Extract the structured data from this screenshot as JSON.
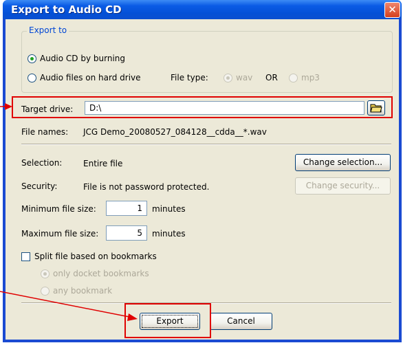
{
  "window": {
    "title": "Export to Audio CD",
    "close_glyph": "✕"
  },
  "export_to": {
    "legend": "Export to",
    "option_burn": "Audio CD by burning",
    "option_files": "Audio files on hard drive",
    "file_type_label": "File type:",
    "wav": "wav",
    "or": "OR",
    "mp3": "mp3",
    "selected": "burn"
  },
  "target_drive": {
    "label": "Target drive:",
    "value": "D:\\"
  },
  "file_names": {
    "label": "File names:",
    "value": "JCG Demo_20080527_084128__cdda__*.wav"
  },
  "selection": {
    "label": "Selection:",
    "value": "Entire file",
    "button": "Change selection..."
  },
  "security": {
    "label": "Security:",
    "value": "File is not password protected.",
    "button": "Change security..."
  },
  "min_size": {
    "label": "Minimum file size:",
    "value": "1",
    "unit": "minutes"
  },
  "max_size": {
    "label": "Maximum file size:",
    "value": "5",
    "unit": "minutes"
  },
  "split": {
    "label": "Split file based on bookmarks",
    "checked": false,
    "option_docket": "only docket bookmarks",
    "option_any": "any bookmark"
  },
  "buttons": {
    "export": "Export",
    "cancel": "Cancel"
  },
  "colors": {
    "accent_blue": "#0046d5",
    "annotation_red": "#e00000",
    "dialog_bg": "#ece9d8"
  },
  "icons": {
    "folder": "folder-open-icon"
  }
}
